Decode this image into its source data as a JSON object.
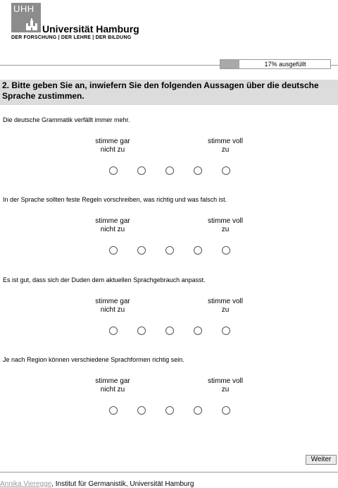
{
  "logo": {
    "mark": "UHH",
    "name": "Universität Hamburg",
    "tagline": "DER FORSCHUNG | DER LEHRE | DER BILDUNG"
  },
  "progress": {
    "label": "17% ausgefüllt",
    "fraction": 0.17
  },
  "question": {
    "title": "2. Bitte geben Sie an, inwiefern Sie den folgenden Aussagen über die deutsche Sprache zustimmen."
  },
  "scale": {
    "left_label": "stimme gar nicht zu",
    "right_label": "stimme voll zu",
    "points": 5
  },
  "items": [
    {
      "statement": "Die deutsche Grammatik verfällt immer mehr."
    },
    {
      "statement": "In der Sprache sollten feste Regeln vorschreiben, was richtig und was falsch ist."
    },
    {
      "statement": "Es ist gut, dass sich der Duden dem aktuellen Sprachgebrauch anpasst."
    },
    {
      "statement": "Je nach Region können verschiedene Sprachformen richtig sein."
    }
  ],
  "navigation": {
    "next_label": "Weiter"
  },
  "footer": {
    "author_link": "Annika Vieregge",
    "institution": ", Institut für Germanistik, Universität Hamburg"
  }
}
